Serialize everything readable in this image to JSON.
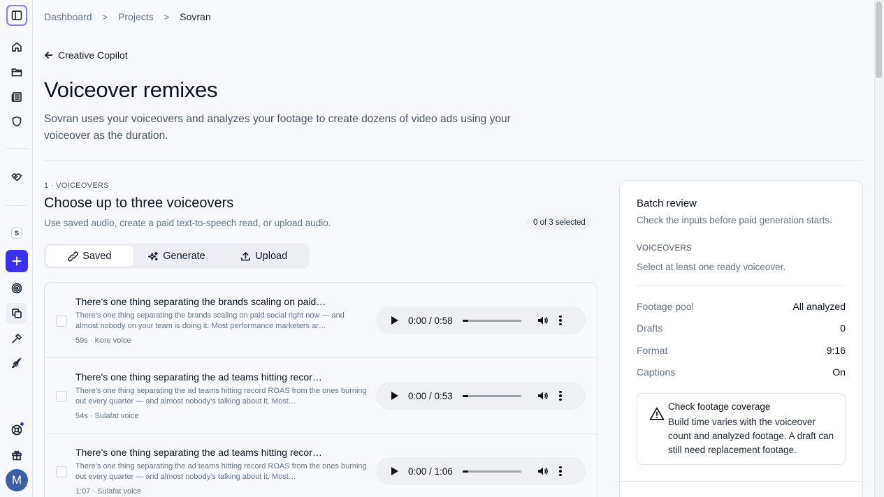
{
  "breadcrumb": {
    "item1": "Dashboard",
    "sep": ">",
    "item2": "Projects",
    "item3": "Sovran"
  },
  "back_label": "Creative Copilot",
  "page": {
    "title": "Voiceover remixes",
    "description": "Sovran uses your voiceovers and analyzes your footage to create dozens of video ads using your voiceover as the duration."
  },
  "voiceovers": {
    "step_label": "1 · VOICEOVERS",
    "title": "Choose up to three voiceovers",
    "subtitle": "Use saved audio, create a paid text-to-speech read, or upload audio.",
    "selected_count": "0 of 3 selected",
    "tabs": [
      {
        "label": "Saved",
        "icon": "link-icon",
        "active": true
      },
      {
        "label": "Generate",
        "icon": "sparkles-icon",
        "active": false
      },
      {
        "label": "Upload",
        "icon": "upload-icon",
        "active": false
      }
    ],
    "items": [
      {
        "title": "There's one thing separating the brands scaling on paid…",
        "text": "There's one thing separating the brands scaling on paid social right now — and almost nobody on your team is doing it. Most performance marketers ar…",
        "meta": "59s · Kore voice",
        "time": "0:00 / 0:58",
        "progress": 0
      },
      {
        "title": "There's one thing separating the ad teams hitting recor…",
        "text": "There's one thing separating the ad teams hitting record ROAS from the ones burning out every quarter — and almost nobody's talking about it. Most…",
        "meta": "54s · Sulafat voice",
        "time": "0:00 / 0:53",
        "progress": 0
      },
      {
        "title": "There's one thing separating the ad teams hitting recor…",
        "text": "There's one thing separating the ad teams hitting record ROAS from the ones burning out every quarter — and almost nobody's talking about it. Most…",
        "meta": "1:07 · Sulafat voice",
        "time": "0:00 / 1:06",
        "progress": 0
      }
    ]
  },
  "batch_review": {
    "title": "Batch review",
    "subtitle": "Check the inputs before paid generation starts.",
    "voiceovers_label": "VOICEOVERS",
    "voiceovers_hint": "Select at least one ready voiceover.",
    "rows": [
      {
        "key": "Footage pool",
        "value": "All analyzed"
      },
      {
        "key": "Drafts",
        "value": "0"
      },
      {
        "key": "Format",
        "value": "9:16"
      },
      {
        "key": "Captions",
        "value": "On"
      }
    ],
    "note_title": "Check footage coverage",
    "note_body": "Build time varies with the voiceover count and analyzed footage. A draft can still need replacement footage."
  },
  "sidebar": {
    "workspace_letter": "S",
    "avatar_letter": "M",
    "icons": [
      "sidebar-toggle-icon",
      "home-icon",
      "folder-icon",
      "newspaper-icon",
      "shield-icon",
      "handshake-icon",
      "plus-icon",
      "target-icon",
      "copy-icon",
      "hammer-icon",
      "rocket-icon",
      "support-icon",
      "gift-icon"
    ]
  },
  "colors": {
    "accent": "#3b2ff0",
    "toggle_border": "#8b7cf6",
    "avatar": "#3d5fa6"
  }
}
